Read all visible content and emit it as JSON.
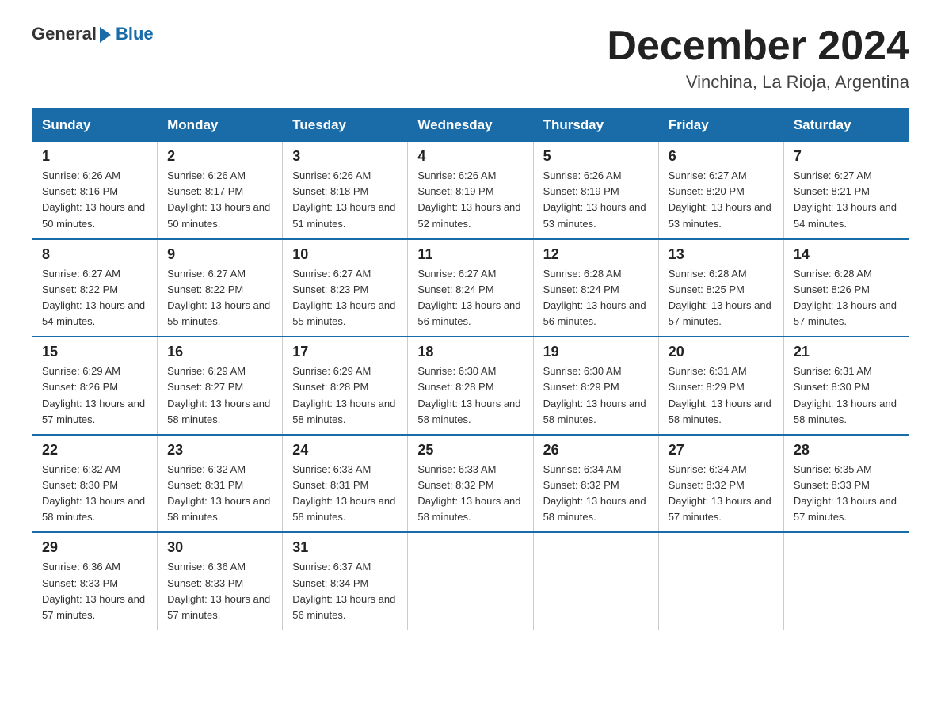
{
  "logo": {
    "text_general": "General",
    "text_blue": "Blue"
  },
  "header": {
    "month_year": "December 2024",
    "location": "Vinchina, La Rioja, Argentina"
  },
  "days_of_week": [
    "Sunday",
    "Monday",
    "Tuesday",
    "Wednesday",
    "Thursday",
    "Friday",
    "Saturday"
  ],
  "weeks": [
    [
      {
        "day": "1",
        "sunrise": "6:26 AM",
        "sunset": "8:16 PM",
        "daylight": "13 hours and 50 minutes."
      },
      {
        "day": "2",
        "sunrise": "6:26 AM",
        "sunset": "8:17 PM",
        "daylight": "13 hours and 50 minutes."
      },
      {
        "day": "3",
        "sunrise": "6:26 AM",
        "sunset": "8:18 PM",
        "daylight": "13 hours and 51 minutes."
      },
      {
        "day": "4",
        "sunrise": "6:26 AM",
        "sunset": "8:19 PM",
        "daylight": "13 hours and 52 minutes."
      },
      {
        "day": "5",
        "sunrise": "6:26 AM",
        "sunset": "8:19 PM",
        "daylight": "13 hours and 53 minutes."
      },
      {
        "day": "6",
        "sunrise": "6:27 AM",
        "sunset": "8:20 PM",
        "daylight": "13 hours and 53 minutes."
      },
      {
        "day": "7",
        "sunrise": "6:27 AM",
        "sunset": "8:21 PM",
        "daylight": "13 hours and 54 minutes."
      }
    ],
    [
      {
        "day": "8",
        "sunrise": "6:27 AM",
        "sunset": "8:22 PM",
        "daylight": "13 hours and 54 minutes."
      },
      {
        "day": "9",
        "sunrise": "6:27 AM",
        "sunset": "8:22 PM",
        "daylight": "13 hours and 55 minutes."
      },
      {
        "day": "10",
        "sunrise": "6:27 AM",
        "sunset": "8:23 PM",
        "daylight": "13 hours and 55 minutes."
      },
      {
        "day": "11",
        "sunrise": "6:27 AM",
        "sunset": "8:24 PM",
        "daylight": "13 hours and 56 minutes."
      },
      {
        "day": "12",
        "sunrise": "6:28 AM",
        "sunset": "8:24 PM",
        "daylight": "13 hours and 56 minutes."
      },
      {
        "day": "13",
        "sunrise": "6:28 AM",
        "sunset": "8:25 PM",
        "daylight": "13 hours and 57 minutes."
      },
      {
        "day": "14",
        "sunrise": "6:28 AM",
        "sunset": "8:26 PM",
        "daylight": "13 hours and 57 minutes."
      }
    ],
    [
      {
        "day": "15",
        "sunrise": "6:29 AM",
        "sunset": "8:26 PM",
        "daylight": "13 hours and 57 minutes."
      },
      {
        "day": "16",
        "sunrise": "6:29 AM",
        "sunset": "8:27 PM",
        "daylight": "13 hours and 58 minutes."
      },
      {
        "day": "17",
        "sunrise": "6:29 AM",
        "sunset": "8:28 PM",
        "daylight": "13 hours and 58 minutes."
      },
      {
        "day": "18",
        "sunrise": "6:30 AM",
        "sunset": "8:28 PM",
        "daylight": "13 hours and 58 minutes."
      },
      {
        "day": "19",
        "sunrise": "6:30 AM",
        "sunset": "8:29 PM",
        "daylight": "13 hours and 58 minutes."
      },
      {
        "day": "20",
        "sunrise": "6:31 AM",
        "sunset": "8:29 PM",
        "daylight": "13 hours and 58 minutes."
      },
      {
        "day": "21",
        "sunrise": "6:31 AM",
        "sunset": "8:30 PM",
        "daylight": "13 hours and 58 minutes."
      }
    ],
    [
      {
        "day": "22",
        "sunrise": "6:32 AM",
        "sunset": "8:30 PM",
        "daylight": "13 hours and 58 minutes."
      },
      {
        "day": "23",
        "sunrise": "6:32 AM",
        "sunset": "8:31 PM",
        "daylight": "13 hours and 58 minutes."
      },
      {
        "day": "24",
        "sunrise": "6:33 AM",
        "sunset": "8:31 PM",
        "daylight": "13 hours and 58 minutes."
      },
      {
        "day": "25",
        "sunrise": "6:33 AM",
        "sunset": "8:32 PM",
        "daylight": "13 hours and 58 minutes."
      },
      {
        "day": "26",
        "sunrise": "6:34 AM",
        "sunset": "8:32 PM",
        "daylight": "13 hours and 58 minutes."
      },
      {
        "day": "27",
        "sunrise": "6:34 AM",
        "sunset": "8:32 PM",
        "daylight": "13 hours and 57 minutes."
      },
      {
        "day": "28",
        "sunrise": "6:35 AM",
        "sunset": "8:33 PM",
        "daylight": "13 hours and 57 minutes."
      }
    ],
    [
      {
        "day": "29",
        "sunrise": "6:36 AM",
        "sunset": "8:33 PM",
        "daylight": "13 hours and 57 minutes."
      },
      {
        "day": "30",
        "sunrise": "6:36 AM",
        "sunset": "8:33 PM",
        "daylight": "13 hours and 57 minutes."
      },
      {
        "day": "31",
        "sunrise": "6:37 AM",
        "sunset": "8:34 PM",
        "daylight": "13 hours and 56 minutes."
      },
      null,
      null,
      null,
      null
    ]
  ],
  "labels": {
    "sunrise_prefix": "Sunrise: ",
    "sunset_prefix": "Sunset: ",
    "daylight_prefix": "Daylight: "
  }
}
